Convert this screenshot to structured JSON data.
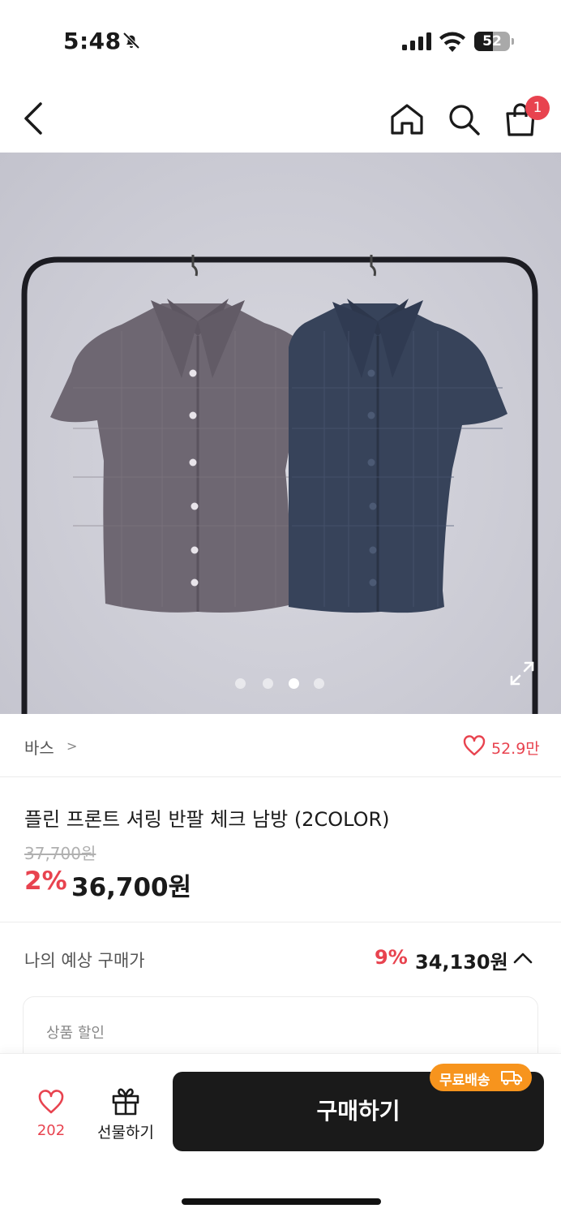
{
  "status_bar": {
    "time": "5:48",
    "battery": "52",
    "battery_level": 0.52,
    "icons": [
      "bell-off-icon",
      "signal-icon",
      "wifi-icon",
      "battery-icon"
    ]
  },
  "nav": {
    "icons": [
      "back-icon",
      "home-icon",
      "search-icon",
      "cart-icon"
    ],
    "cart_count": "1"
  },
  "gallery": {
    "image": "two short-sleeve check shirts (grey and navy) on a hanger rack",
    "page_count": 4,
    "current_page": 3,
    "expand_icon": "expand-icon"
  },
  "brand": {
    "name": "바스",
    "chevron": ">",
    "likes": "52.9만"
  },
  "product": {
    "title": "플린 프론트 셔링 반팔 체크 남방 (2COLOR)",
    "original_price": "37,700원",
    "discount_rate": "2%",
    "sale_price": "36,700원"
  },
  "expected": {
    "label": "나의 예상 구매가",
    "discount_rate": "9%",
    "price": "34,130원"
  },
  "discount_card": {
    "title": "상품 할인"
  },
  "bottom": {
    "wish_count": "202",
    "gift_label": "선물하기",
    "buy_label": "구매하기",
    "free_ship_label": "무료배송"
  },
  "colors": {
    "accent_red": "#e8434f",
    "button_dark": "#1a1a1a",
    "badge_orange": "#f7941d"
  }
}
